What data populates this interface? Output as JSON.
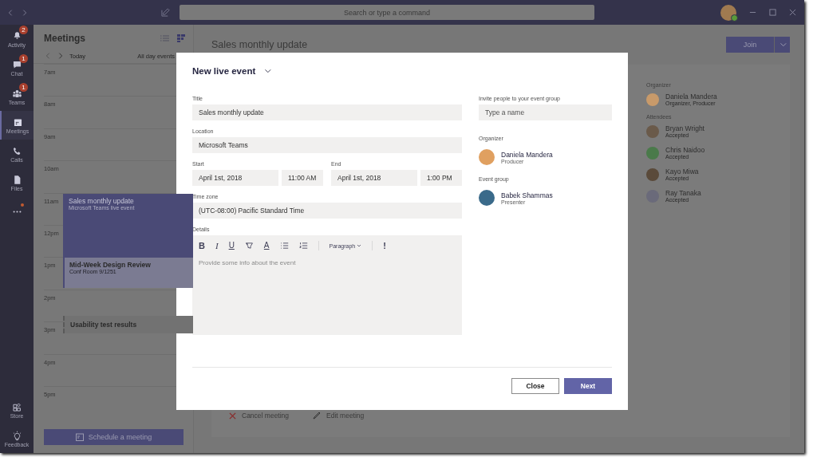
{
  "title_bar": {
    "search_placeholder": "Search or type a command"
  },
  "app_bar": {
    "items": [
      {
        "label": "Activity",
        "badge": "2",
        "selected": false,
        "notification": false
      },
      {
        "label": "Chat",
        "badge": "1",
        "selected": false,
        "notification": false
      },
      {
        "label": "Teams",
        "badge": "1",
        "selected": false,
        "notification": false
      },
      {
        "label": "Meetings",
        "selected": true,
        "notification": false
      },
      {
        "label": "Calls",
        "selected": false,
        "notification": false
      },
      {
        "label": "Files",
        "selected": false,
        "notification": false
      },
      {
        "selected": false,
        "notification": true
      }
    ],
    "bottom": [
      "Store",
      "Feedback"
    ]
  },
  "meetings_panel": {
    "title": "Meetings",
    "today": "Today",
    "all_day": "All day events",
    "hours": [
      {
        "label": "7am"
      },
      {
        "label": "8am"
      },
      {
        "label": "9am"
      },
      {
        "label": "10am"
      },
      {
        "label": "11am",
        "event": {
          "kind": "live",
          "title": "Sales monthly update",
          "subtitle": "Microsoft Teams live event"
        }
      },
      {
        "label": "12pm"
      },
      {
        "label": "1pm",
        "event": {
          "kind": "meeting",
          "title": "Mid-Week Design Review",
          "subtitle": "Conf Room 9/1251"
        }
      },
      {
        "label": "2pm"
      },
      {
        "label": "3pm",
        "event": {
          "kind": "tentative",
          "title": "Usability test results"
        }
      },
      {
        "label": "4pm"
      },
      {
        "label": "5pm"
      }
    ],
    "schedule_button": "Schedule a meeting"
  },
  "meeting_view": {
    "title": "Sales monthly update",
    "join": "Join",
    "organizer_heading": "Organizer",
    "organizer": {
      "name": "Daniela Mandera",
      "role": "Organizer, Producer",
      "color": "#c89a6a"
    },
    "attendees_heading": "Attendees",
    "attendees": [
      {
        "name": "Bryan Wright",
        "status": "Accepted",
        "color": "#6a5a4a"
      },
      {
        "name": "Chris Naidoo",
        "status": "Accepted",
        "color": "#4a7a4a"
      },
      {
        "name": "Kayo Miwa",
        "status": "Accepted",
        "color": "#5a4a3a"
      },
      {
        "name": "Ray Tanaka",
        "status": "Accepted",
        "color": "#6a6a7a"
      }
    ],
    "actions": [
      "Cancel meeting",
      "Edit meeting"
    ]
  },
  "dialog": {
    "title": "New live event",
    "title_label": "Title",
    "title_value": "Sales monthly update",
    "location_label": "Location",
    "location_value": "Microsoft Teams",
    "start_label": "Start",
    "start_date": "April 1st, 2018",
    "start_time": "11:00 AM",
    "end_label": "End",
    "end_date": "April 1st, 2018",
    "end_time": "1:00 PM",
    "timezone_label": "Time zone",
    "timezone_value": "(UTC-08:00) Pacific Standard Time",
    "details_label": "Details",
    "toolbar": [
      {
        "kind": "bold",
        "label": "B"
      },
      {
        "kind": "italic",
        "label": "I"
      },
      {
        "kind": "underline",
        "label": "U"
      },
      {
        "kind": "highlight"
      },
      {
        "kind": "color",
        "label": "A"
      },
      {
        "kind": "bullets"
      },
      {
        "kind": "numbers"
      },
      {
        "kind": "paragraph",
        "label": "Paragraph"
      },
      {
        "kind": "important",
        "label": "!"
      }
    ],
    "details_placeholder": "Provide some info about the event",
    "invite_label": "Invite people to your event group",
    "invite_placeholder": "Type a name",
    "organizer_label": "Organizer",
    "organizer": {
      "name": "Daniela Mandera",
      "role": "Producer",
      "color": "#e0a060"
    },
    "group_label": "Event group",
    "group": [
      {
        "name": "Babek Shammas",
        "role": "Presenter",
        "color": "#3a6a8a"
      }
    ],
    "buttons": [
      "Close",
      "Next"
    ]
  }
}
